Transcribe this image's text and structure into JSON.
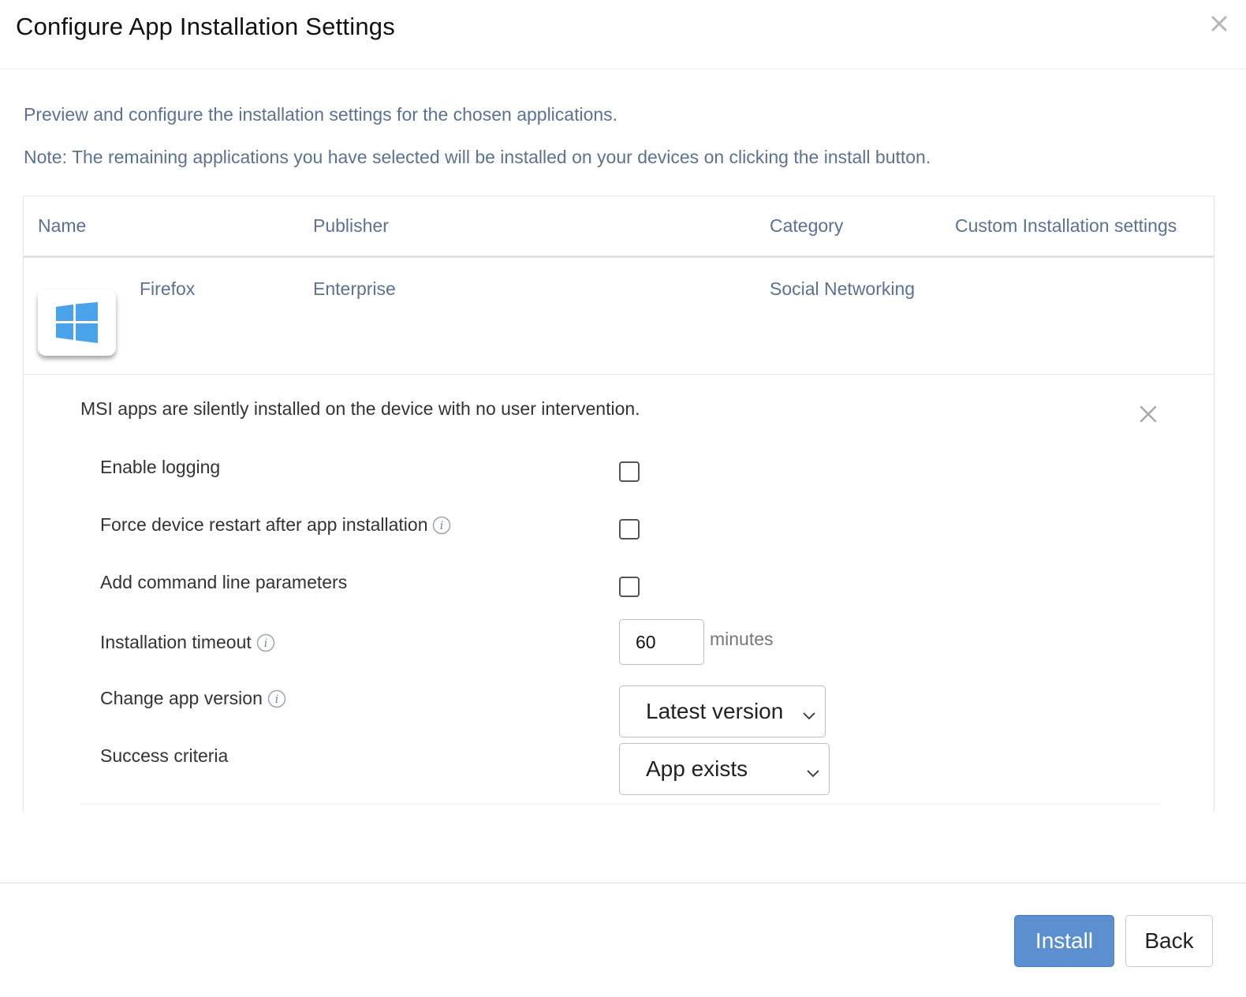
{
  "dialog": {
    "title": "Configure App Installation Settings"
  },
  "intro": {
    "line1": "Preview and configure the installation settings for the chosen applications.",
    "line2": "Note: The remaining applications you have selected will be installed on your devices on clicking the install button."
  },
  "table": {
    "headers": {
      "name": "Name",
      "publisher": "Publisher",
      "category": "Category",
      "custom": "Custom Installation settings"
    },
    "rows": [
      {
        "icon": "windows-logo-icon",
        "name": "Firefox",
        "publisher": "Enterprise",
        "category": "Social Networking"
      }
    ]
  },
  "settings": {
    "note": "MSI apps are silently installed on the device with no user intervention.",
    "enable_logging": {
      "label": "Enable logging",
      "checked": false
    },
    "force_restart": {
      "label": "Force device restart after app installation",
      "checked": false
    },
    "command_line": {
      "label": "Add command line parameters",
      "checked": false
    },
    "timeout": {
      "label": "Installation timeout",
      "value": "60",
      "unit": "minutes"
    },
    "app_version": {
      "label": "Change app version",
      "selected": "Latest version"
    },
    "success_criteria": {
      "label": "Success criteria",
      "selected": "App exists"
    }
  },
  "footer": {
    "install_label": "Install",
    "back_label": "Back"
  },
  "colors": {
    "accent": "#5b8fd0",
    "muted_text": "#5b7291",
    "windows_blue": "#4aa3ea"
  }
}
